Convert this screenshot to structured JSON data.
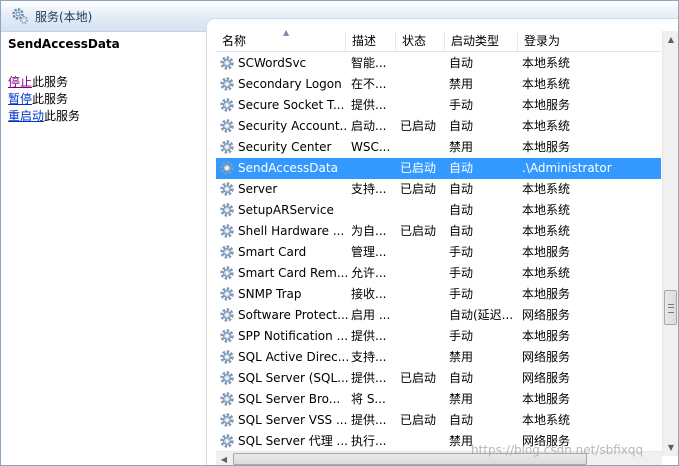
{
  "window": {
    "title": "服务(本地)"
  },
  "left_pane": {
    "service_name": "SendAccessData",
    "actions": [
      {
        "link": "停止",
        "suffix": "此服务",
        "visited": true
      },
      {
        "link": "暂停",
        "suffix": "此服务",
        "visited": false
      },
      {
        "link": "重启动",
        "suffix": "此服务",
        "visited": false
      }
    ]
  },
  "table": {
    "columns": [
      "名称",
      "描述",
      "状态",
      "启动类型",
      "登录为"
    ],
    "sort_column": "名称",
    "selected_index": 5,
    "rows": [
      {
        "name": "SCWordSvc",
        "desc": "智能...",
        "status": "",
        "startup": "自动",
        "logon": "本地系统"
      },
      {
        "name": "Secondary Logon",
        "desc": "在不...",
        "status": "",
        "startup": "禁用",
        "logon": "本地系统"
      },
      {
        "name": "Secure Socket T...",
        "desc": "提供...",
        "status": "",
        "startup": "手动",
        "logon": "本地服务"
      },
      {
        "name": "Security Account...",
        "desc": "启动...",
        "status": "已启动",
        "startup": "自动",
        "logon": "本地系统"
      },
      {
        "name": "Security Center",
        "desc": "WSC...",
        "status": "",
        "startup": "禁用",
        "logon": "本地服务"
      },
      {
        "name": "SendAccessData",
        "desc": "",
        "status": "已启动",
        "startup": "自动",
        "logon": ".\\Administrator"
      },
      {
        "name": "Server",
        "desc": "支持...",
        "status": "已启动",
        "startup": "自动",
        "logon": "本地系统"
      },
      {
        "name": "SetupARService",
        "desc": "",
        "status": "",
        "startup": "自动",
        "logon": "本地系统"
      },
      {
        "name": "Shell Hardware ...",
        "desc": "为自...",
        "status": "已启动",
        "startup": "自动",
        "logon": "本地系统"
      },
      {
        "name": "Smart Card",
        "desc": "管理...",
        "status": "",
        "startup": "手动",
        "logon": "本地服务"
      },
      {
        "name": "Smart Card Rem...",
        "desc": "允许...",
        "status": "",
        "startup": "手动",
        "logon": "本地系统"
      },
      {
        "name": "SNMP Trap",
        "desc": "接收...",
        "status": "",
        "startup": "手动",
        "logon": "本地服务"
      },
      {
        "name": "Software Protect...",
        "desc": "启用 ...",
        "status": "",
        "startup": "自动(延迟...",
        "logon": "网络服务"
      },
      {
        "name": "SPP Notification ...",
        "desc": "提供...",
        "status": "",
        "startup": "手动",
        "logon": "本地服务"
      },
      {
        "name": "SQL Active Direc...",
        "desc": "支持...",
        "status": "",
        "startup": "禁用",
        "logon": "网络服务"
      },
      {
        "name": "SQL Server (SQL...",
        "desc": "提供...",
        "status": "已启动",
        "startup": "自动",
        "logon": "网络服务"
      },
      {
        "name": "SQL Server Bro...",
        "desc": "将 S...",
        "status": "",
        "startup": "禁用",
        "logon": "本地服务"
      },
      {
        "name": "SQL Server VSS ...",
        "desc": "提供...",
        "status": "已启动",
        "startup": "自动",
        "logon": "本地系统"
      },
      {
        "name": "SQL Server 代理 ...",
        "desc": "执行...",
        "status": "",
        "startup": "禁用",
        "logon": "网络服务"
      }
    ]
  },
  "scrollbars": {
    "vertical_position": 0.68,
    "vertical_visible_fraction": 0.09,
    "horizontal_position": 0.0,
    "horizontal_visible_fraction": 0.86
  },
  "watermark": "https://blog.csdn.net/sbfixqq",
  "colors": {
    "selection": "#3399ff",
    "visited_link": "#800080",
    "link": "#0033cc",
    "title_text": "#1e395b"
  },
  "icons": {
    "title": "services-gear-icon",
    "row": "gear-icon"
  }
}
